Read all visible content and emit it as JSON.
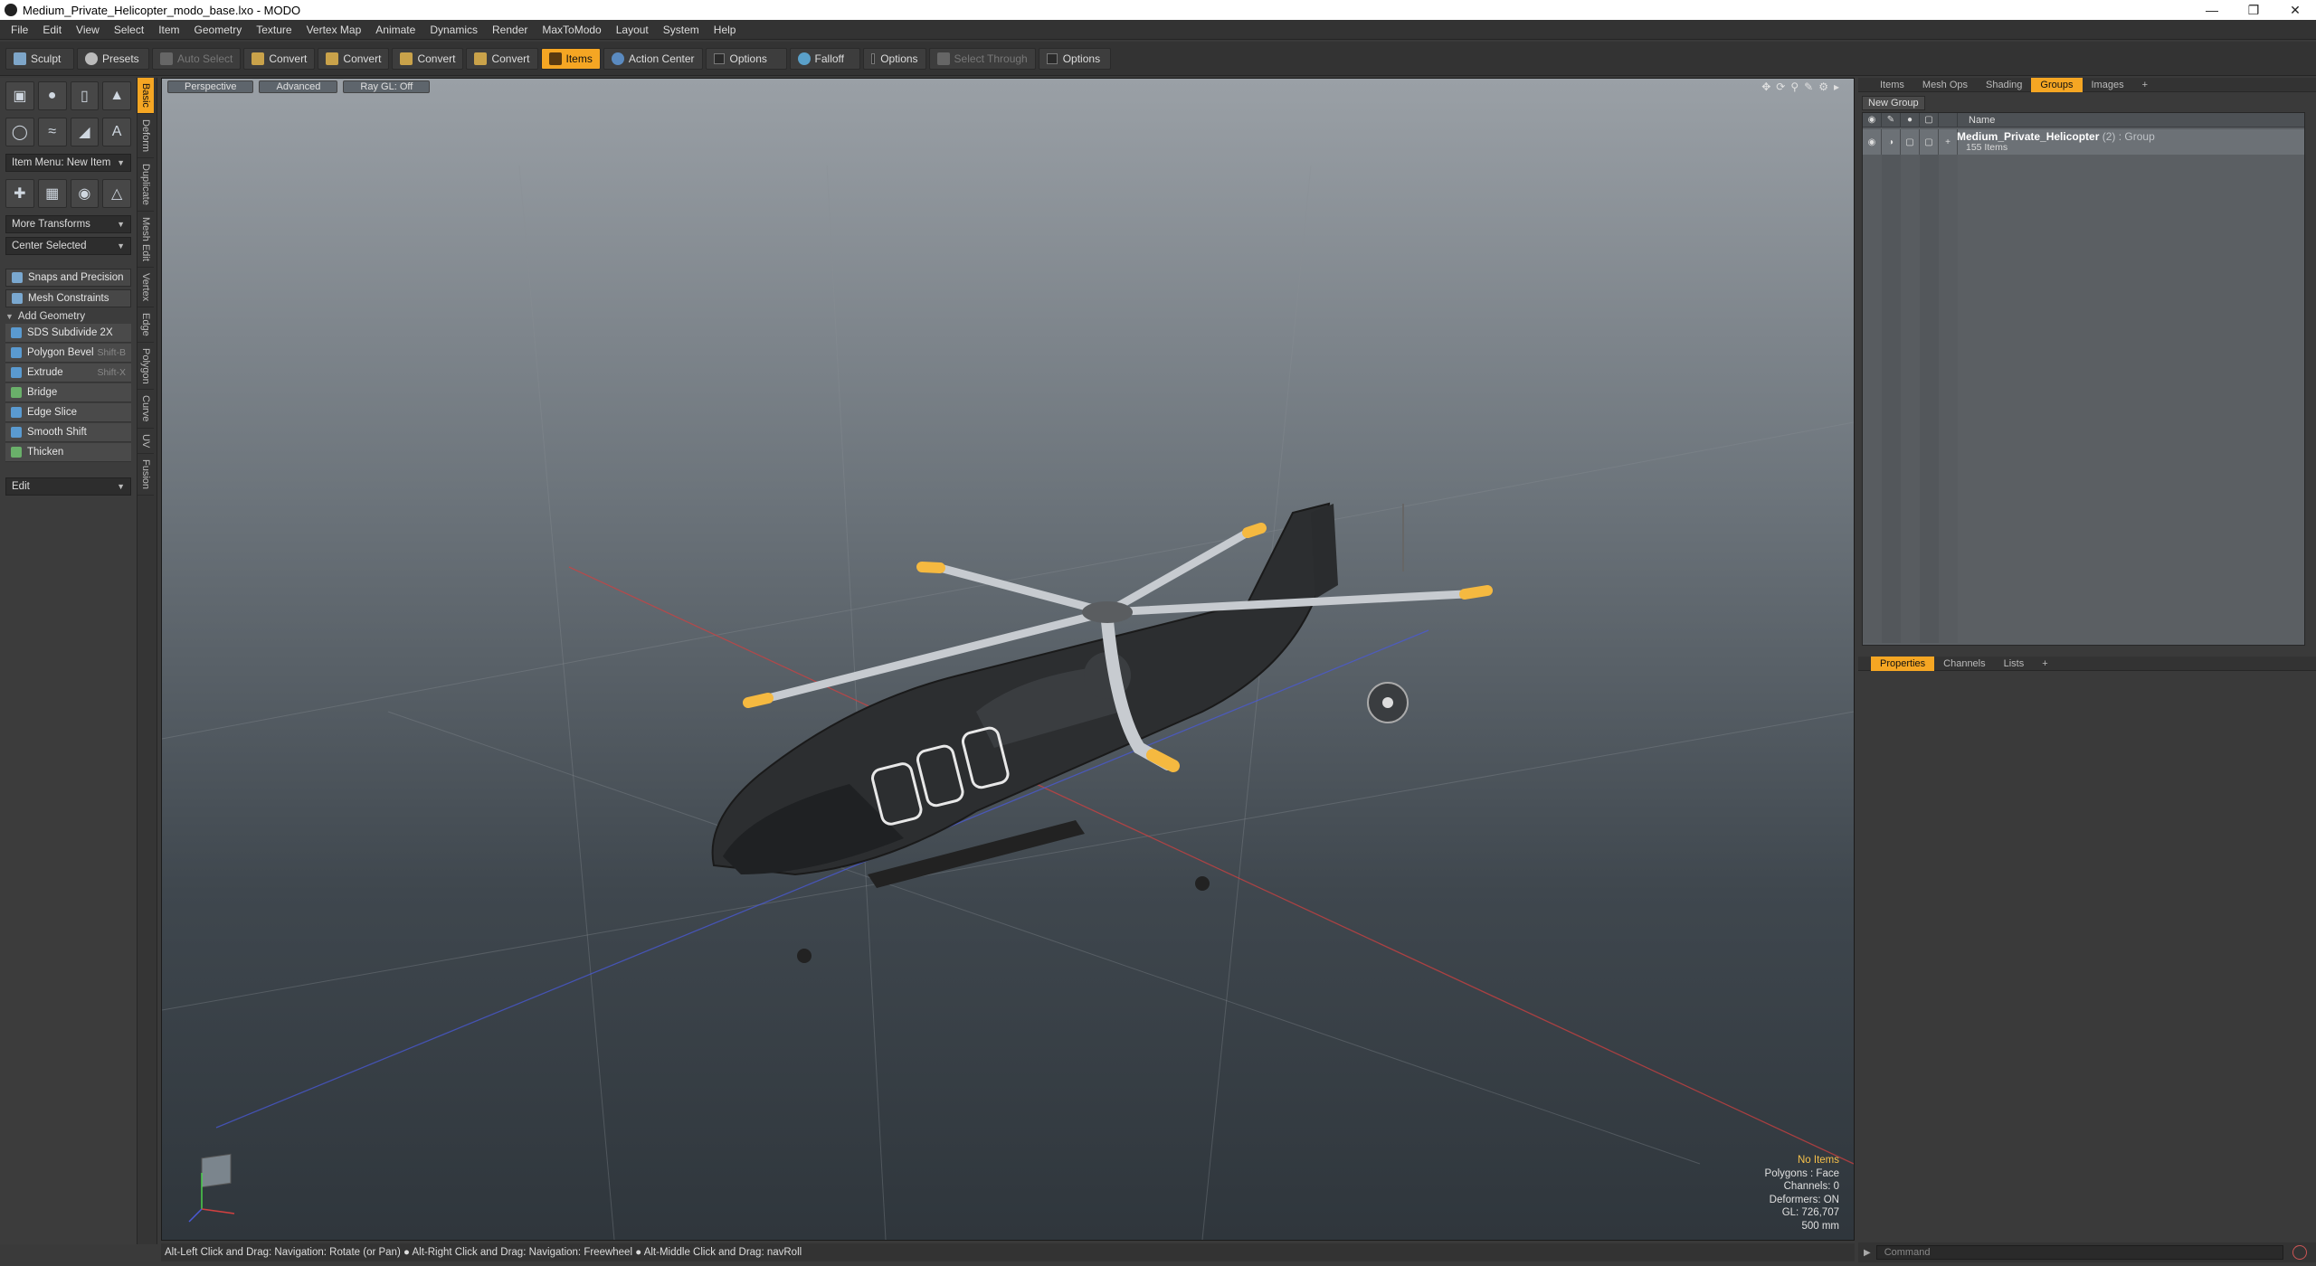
{
  "window": {
    "title": "Medium_Private_Helicopter_modo_base.lxo - MODO"
  },
  "menu": [
    "File",
    "Edit",
    "View",
    "Select",
    "Item",
    "Geometry",
    "Texture",
    "Vertex Map",
    "Animate",
    "Dynamics",
    "Render",
    "MaxToModo",
    "Layout",
    "System",
    "Help"
  ],
  "toolbar": {
    "sculpt": "Sculpt",
    "presets": "Presets",
    "auto_select": "Auto Select",
    "convert1": "Convert",
    "convert2": "Convert",
    "convert3": "Convert",
    "convert4": "Convert",
    "items": "Items",
    "action_center": "Action Center",
    "options1": "Options",
    "falloff": "Falloff",
    "options2": "Options",
    "select_through": "Select Through",
    "options3": "Options"
  },
  "left_panel": {
    "item_menu": "Item Menu: New Item",
    "more_transforms": "More Transforms",
    "center_selected": "Center Selected",
    "snaps": "Snaps and Precision",
    "mesh_constraints": "Mesh Constraints",
    "add_geometry": "Add Geometry",
    "tools": [
      {
        "label": "SDS Subdivide 2X",
        "shortcut": ""
      },
      {
        "label": "Polygon Bevel",
        "shortcut": "Shift-B"
      },
      {
        "label": "Extrude",
        "shortcut": "Shift-X"
      },
      {
        "label": "Bridge",
        "shortcut": ""
      },
      {
        "label": "Edge Slice",
        "shortcut": ""
      },
      {
        "label": "Smooth Shift",
        "shortcut": ""
      },
      {
        "label": "Thicken",
        "shortcut": ""
      }
    ],
    "edit": "Edit"
  },
  "vertical_tabs": [
    "Basic",
    "Deform",
    "Duplicate",
    "Mesh Edit",
    "Vertex",
    "Edge",
    "Polygon",
    "Curve",
    "UV",
    "Fusion"
  ],
  "viewport": {
    "perspective": "Perspective",
    "advanced": "Advanced",
    "raygl": "Ray GL: Off",
    "info": {
      "items": "No Items",
      "polygons": "Polygons : Face",
      "channels": "Channels: 0",
      "deformers": "Deformers: ON",
      "gl": "GL: 726,707",
      "units": "500 mm"
    }
  },
  "status": "Alt-Left Click and Drag: Navigation: Rotate (or Pan) ● Alt-Right Click and Drag: Navigation: Freewheel ● Alt-Middle Click and Drag: navRoll",
  "right_panel": {
    "tabs": [
      "Items",
      "Mesh Ops",
      "Shading",
      "Groups",
      "Images"
    ],
    "active_tab": "Groups",
    "new_group": "New Group",
    "name_header": "Name",
    "group_name": "Medium_Private_Helicopter",
    "group_suffix": "(2) : Group",
    "group_count": "155 Items",
    "bottom_tabs": [
      "Properties",
      "Channels",
      "Lists"
    ],
    "command_placeholder": "Command"
  },
  "colors": {
    "accent": "#f5a623"
  }
}
